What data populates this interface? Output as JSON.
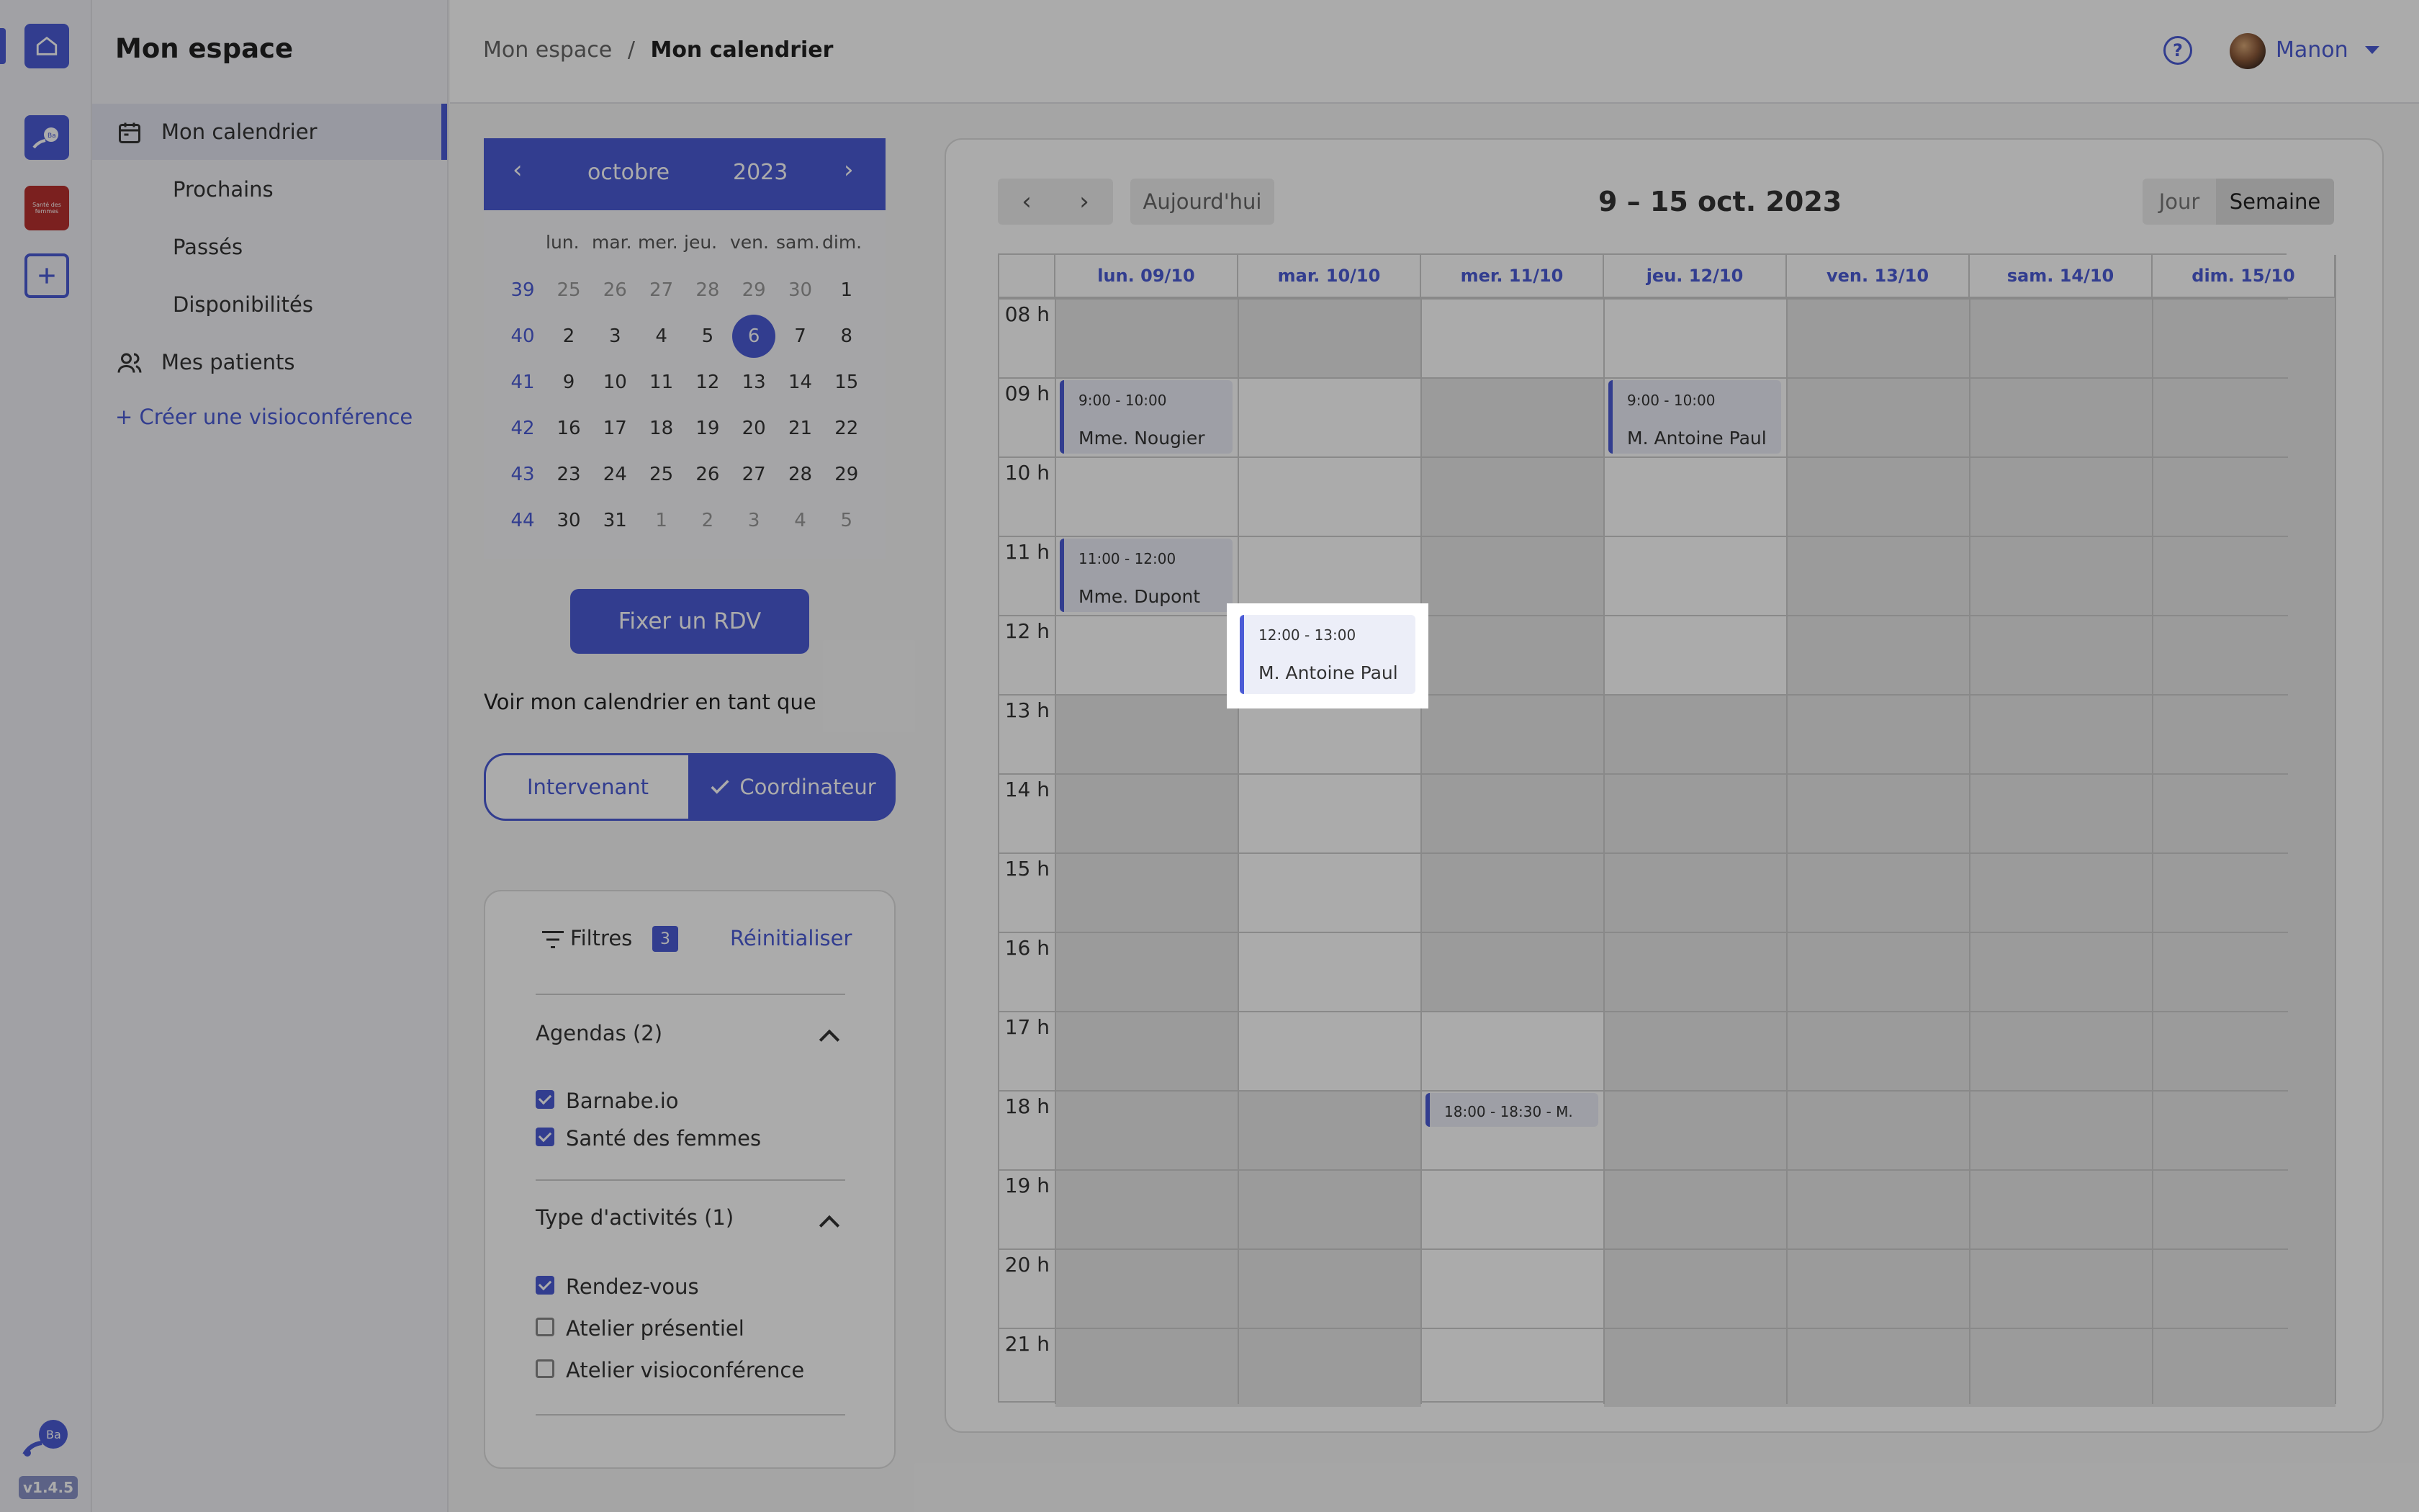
{
  "app": {
    "version": "v1.4.5",
    "rail_sf_label": "Santé des femmes",
    "rail_ba_label": "Ba",
    "accent": "#4b5bd6"
  },
  "sidebar": {
    "title": "Mon espace",
    "calendar_label": "Mon calendrier",
    "sub_items": [
      "Prochains",
      "Passés",
      "Disponibilités"
    ],
    "patients_label": "Mes patients",
    "create_label": "+ Créer une visioconférence"
  },
  "header": {
    "breadcrumb_root": "Mon espace",
    "breadcrumb_sep": "/",
    "breadcrumb_current": "Mon calendrier",
    "help_icon": "?",
    "user_name": "Manon"
  },
  "mini_calendar": {
    "prev": "‹",
    "next": "›",
    "month": "octobre",
    "year": "2023",
    "weekdays": [
      "lun.",
      "mar.",
      "mer.",
      "jeu.",
      "ven.",
      "sam.",
      "dim."
    ],
    "weeks": [
      {
        "wk": "39",
        "days": [
          "25",
          "26",
          "27",
          "28",
          "29",
          "30",
          "1"
        ]
      },
      {
        "wk": "40",
        "days": [
          "2",
          "3",
          "4",
          "5",
          "6",
          "7",
          "8"
        ]
      },
      {
        "wk": "41",
        "days": [
          "9",
          "10",
          "11",
          "12",
          "13",
          "14",
          "15"
        ]
      },
      {
        "wk": "42",
        "days": [
          "16",
          "17",
          "18",
          "19",
          "20",
          "21",
          "22"
        ]
      },
      {
        "wk": "43",
        "days": [
          "23",
          "24",
          "25",
          "26",
          "27",
          "28",
          "29"
        ]
      },
      {
        "wk": "44",
        "days": [
          "30",
          "31",
          "1",
          "2",
          "3",
          "4",
          "5"
        ]
      }
    ],
    "today": "6"
  },
  "actions": {
    "rdv_label": "Fixer un RDV",
    "view_as_label": "Voir mon calendrier en tant que",
    "role_a": "Intervenant",
    "role_b": "Coordinateur"
  },
  "filters": {
    "title": "Filtres",
    "count": "3",
    "reset": "Réinitialiser",
    "agendas_title": "Agendas (2)",
    "agendas": [
      {
        "label": "Barnabe.io",
        "checked": true
      },
      {
        "label": "Santé des femmes",
        "checked": true
      }
    ],
    "types_title": "Type d'activités (1)",
    "types": [
      {
        "label": "Rendez-vous",
        "checked": true
      },
      {
        "label": "Atelier présentiel",
        "checked": false
      },
      {
        "label": "Atelier visioconférence",
        "checked": false
      }
    ]
  },
  "calendar": {
    "prev": "‹",
    "next": "›",
    "today_btn": "Aujourd'hui",
    "range": "9 – 15 oct. 2023",
    "view_day": "Jour",
    "view_week": "Semaine",
    "days": [
      "lun. 09/10",
      "mar. 10/10",
      "mer. 11/10",
      "jeu. 12/10",
      "ven. 13/10",
      "sam. 14/10",
      "dim. 15/10"
    ],
    "hours": [
      "08 h",
      "09 h",
      "10 h",
      "11 h",
      "12 h",
      "13 h",
      "14 h",
      "15 h",
      "16 h",
      "17 h",
      "18 h",
      "19 h",
      "20 h",
      "21 h"
    ],
    "events": [
      {
        "time": "9:00 - 10:00",
        "name": "Mme. Nougier"
      },
      {
        "time": "9:00 - 10:00",
        "name": "M. Antoine Paul"
      },
      {
        "time": "11:00 - 12:00",
        "name": "Mme. Dupont"
      },
      {
        "time": "12:00 - 13:00",
        "name": "M. Antoine Paul"
      },
      {
        "time": "18:00 - 18:30 - M.",
        "name": ""
      }
    ]
  }
}
